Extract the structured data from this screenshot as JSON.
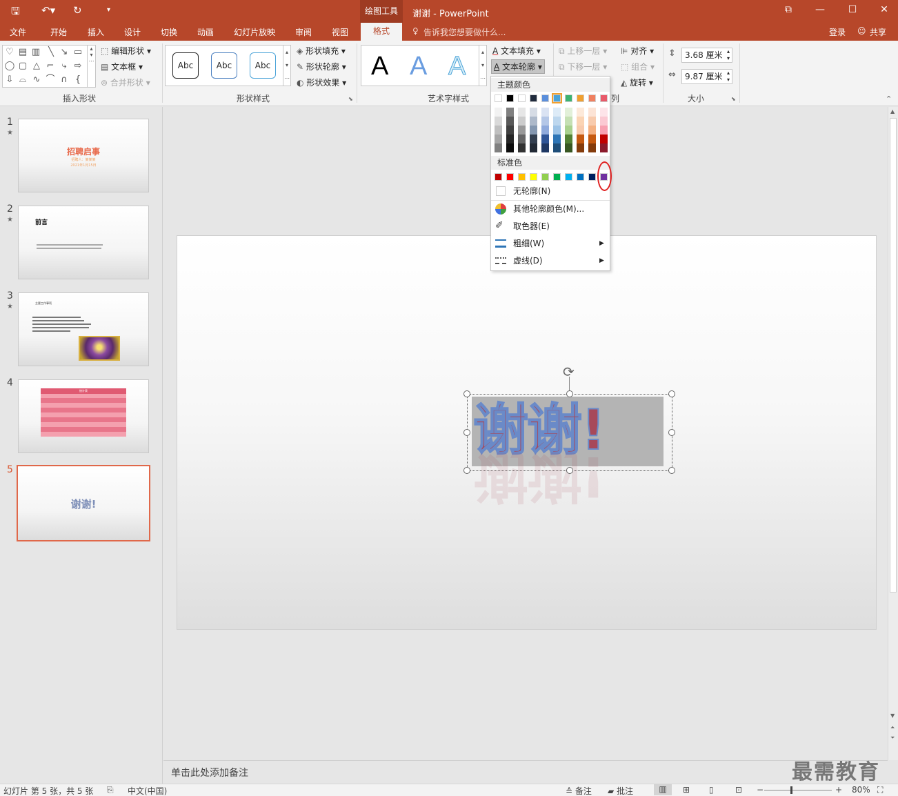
{
  "titlebar": {
    "context_tab": "绘图工具",
    "doc_title": "谢谢 - PowerPoint",
    "qa_icons": [
      "save-icon",
      "undo-icon",
      "redo-icon",
      "customize-icon"
    ]
  },
  "tabs": [
    "文件",
    "开始",
    "插入",
    "设计",
    "切换",
    "动画",
    "幻灯片放映",
    "审阅",
    "视图"
  ],
  "active_tab": "格式",
  "tell_me": "告诉我您想要做什么...",
  "account": {
    "login": "登录",
    "share": "共享"
  },
  "ribbon": {
    "insert_shapes": {
      "label": "插入形状",
      "edit_shape": "编辑形状",
      "text_box": "文本框",
      "merge_shapes": "合并形状"
    },
    "shape_styles": {
      "label": "形状样式",
      "sample": "Abc",
      "fill": "形状填充",
      "outline": "形状轮廓",
      "effects": "形状效果"
    },
    "wordart": {
      "label": "艺术字样式",
      "sample": "A",
      "text_fill": "文本填充",
      "text_outline": "文本轮廓"
    },
    "arrange": {
      "label": "列",
      "bring_forward": "上移一层",
      "send_backward": "下移一层",
      "align": "对齐",
      "group": "组合",
      "rotate": "旋转"
    },
    "size": {
      "label": "大小",
      "height": "3.68 厘米",
      "width": "9.87 厘米"
    }
  },
  "outline_dropdown": {
    "theme_colors_label": "主题颜色",
    "standard_colors_label": "标准色",
    "theme_top": [
      "#ffffff",
      "#000000",
      "#ffffff",
      "#1f2a3c",
      "#5b8fdc",
      "#4aa3d8",
      "#3cb371",
      "#f0a030",
      "#f08060",
      "#e85a6a"
    ],
    "theme_columns": [
      [
        "#f2f2f2",
        "#d9d9d9",
        "#bfbfbf",
        "#a6a6a6",
        "#808080"
      ],
      [
        "#808080",
        "#595959",
        "#404040",
        "#262626",
        "#0d0d0d"
      ],
      [
        "#e6e6e6",
        "#cccccc",
        "#999999",
        "#666666",
        "#333333"
      ],
      [
        "#d6dce5",
        "#adb9ca",
        "#8497b0",
        "#333f50",
        "#222a35"
      ],
      [
        "#dae3f3",
        "#b4c7e7",
        "#8faadc",
        "#2f5597",
        "#1f3864"
      ],
      [
        "#ddebf7",
        "#bdd7ee",
        "#9dc3e6",
        "#2e75b6",
        "#1f4e79"
      ],
      [
        "#e2f0d9",
        "#c5e0b4",
        "#a9d18e",
        "#548235",
        "#385723"
      ],
      [
        "#fde9d9",
        "#fbd4b4",
        "#f8cbad",
        "#c55a11",
        "#843c0c"
      ],
      [
        "#fce4d6",
        "#f8cbad",
        "#f4b183",
        "#c55a11",
        "#843c0c"
      ],
      [
        "#fde4e9",
        "#fbc9d3",
        "#f8a0b1",
        "#c00000",
        "#8b1a2b"
      ]
    ],
    "standard": [
      "#c00000",
      "#ff0000",
      "#ffc000",
      "#ffff00",
      "#92d050",
      "#00b050",
      "#00b0f0",
      "#0070c0",
      "#002060",
      "#7030a0"
    ],
    "no_outline": "无轮廓(N)",
    "more_colors": "其他轮廓颜色(M)...",
    "eyedropper": "取色器(E)",
    "weight": "粗细(W)",
    "dashes": "虚线(D)"
  },
  "slides": [
    {
      "num": "1",
      "title": "招聘启事",
      "sub1": "招聘人：某某某",
      "sub2": "2021年1月15日"
    },
    {
      "num": "2",
      "title": "前言"
    },
    {
      "num": "3",
      "title": "主要工作事项"
    },
    {
      "num": "4",
      "title": "统计表"
    },
    {
      "num": "5",
      "title": "谢谢!"
    }
  ],
  "slide_text": "谢谢!",
  "notes_placeholder": "单击此处添加备注",
  "watermark": "最需教育",
  "status": {
    "slide_info": "幻灯片 第 5 张，共 5 张",
    "language": "中文(中国)",
    "notes": "备注",
    "comments": "批注",
    "zoom": "80%"
  }
}
